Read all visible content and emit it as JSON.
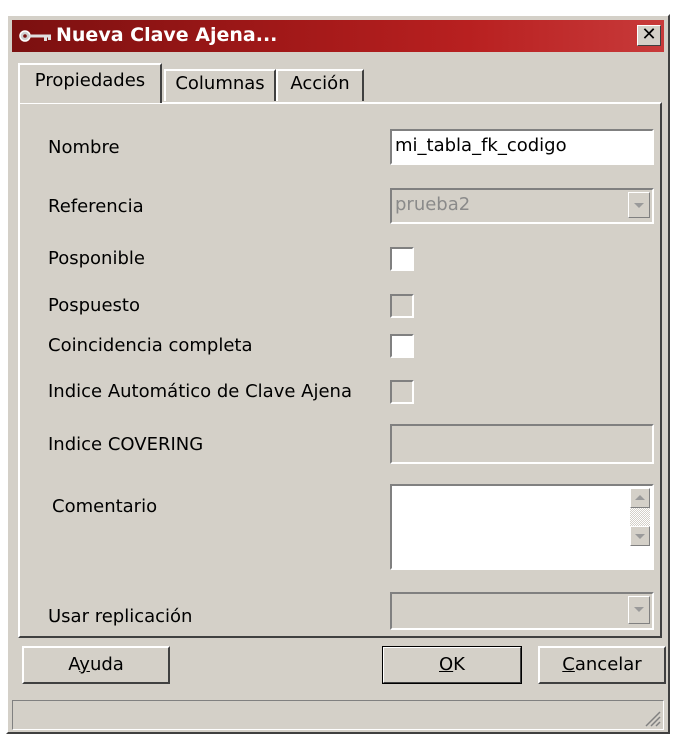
{
  "window": {
    "title": "Nueva Clave Ajena...",
    "close_glyph": "✕"
  },
  "tabs": [
    {
      "label": "Propiedades",
      "active": true
    },
    {
      "label": "Columnas",
      "active": false
    },
    {
      "label": "Acción",
      "active": false
    }
  ],
  "form": {
    "nombre": {
      "label": "Nombre",
      "value": "mi_tabla_fk_codigo"
    },
    "referencia": {
      "label": "Referencia",
      "value": "prueba2",
      "enabled": false
    },
    "posponible": {
      "label": "Posponible",
      "checked": false,
      "enabled": true
    },
    "pospuesto": {
      "label": "Pospuesto",
      "checked": false,
      "enabled": false
    },
    "coincidencia": {
      "label": "Coincidencia completa",
      "checked": false,
      "enabled": true
    },
    "indice_auto": {
      "label": "Indice Automático de Clave Ajena",
      "checked": false,
      "enabled": false
    },
    "covering": {
      "label": "Indice COVERING",
      "value": "",
      "enabled": false
    },
    "comentario": {
      "label": "Comentario",
      "value": ""
    },
    "replicacion": {
      "label": "Usar replicación",
      "value": "",
      "enabled": false
    }
  },
  "buttons": {
    "help": {
      "prefix": "A",
      "mnemonic": "y",
      "suffix": "uda"
    },
    "ok": {
      "prefix": "",
      "mnemonic": "O",
      "suffix": "K"
    },
    "cancel": {
      "prefix": "",
      "mnemonic": "C",
      "suffix": "ancelar"
    }
  },
  "icons": {
    "title": "key-icon",
    "close": "close-icon",
    "dropdown": "chevron-down-icon",
    "scroll_up": "scroll-up-icon",
    "scroll_down": "scroll-down-icon",
    "resize": "resize-grip-icon"
  },
  "colors": {
    "titlebar_start": "#7b1010",
    "titlebar_end": "#c83a3a",
    "face": "#d4d0c8",
    "disabled_text": "#8a8a8a"
  }
}
